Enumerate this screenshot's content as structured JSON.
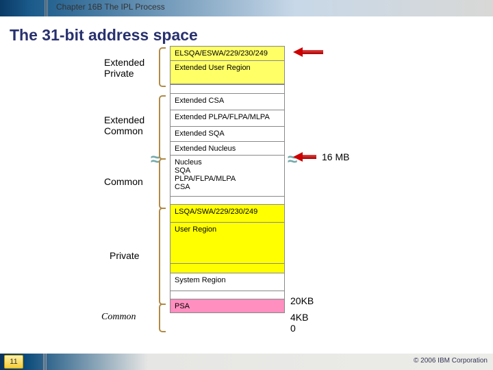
{
  "header": {
    "chapter": "Chapter 16B  The IPL Process"
  },
  "title": "The 31-bit address space",
  "left_labels": {
    "ext_private": "Extended\nPrivate",
    "ext_common": "Extended\nCommon",
    "common": "Common",
    "private": "Private",
    "common2": "Common"
  },
  "segments": {
    "elsqa": "ELSQA/ESWA/229/230/249",
    "ext_user": "Extended User Region",
    "ext_csa": "Extended CSA",
    "ext_plpa": "Extended PLPA/FLPA/MLPA",
    "ext_sqa": "Extended SQA",
    "ext_nucleus": "Extended Nucleus",
    "nuc_group": "Nucleus\nSQA\nPLPA/FLPA/MLPA\nCSA",
    "lsqa": "LSQA/SWA/229/230/249",
    "user_region": "User Region",
    "sys_region": "System Region",
    "psa": "PSA"
  },
  "right_labels": {
    "mb16": "16 MB",
    "kb20": "20KB",
    "kb4": "4KB",
    "zero": "0"
  },
  "footer": {
    "page": "11",
    "copyright": "© 2006 IBM Corporation"
  }
}
